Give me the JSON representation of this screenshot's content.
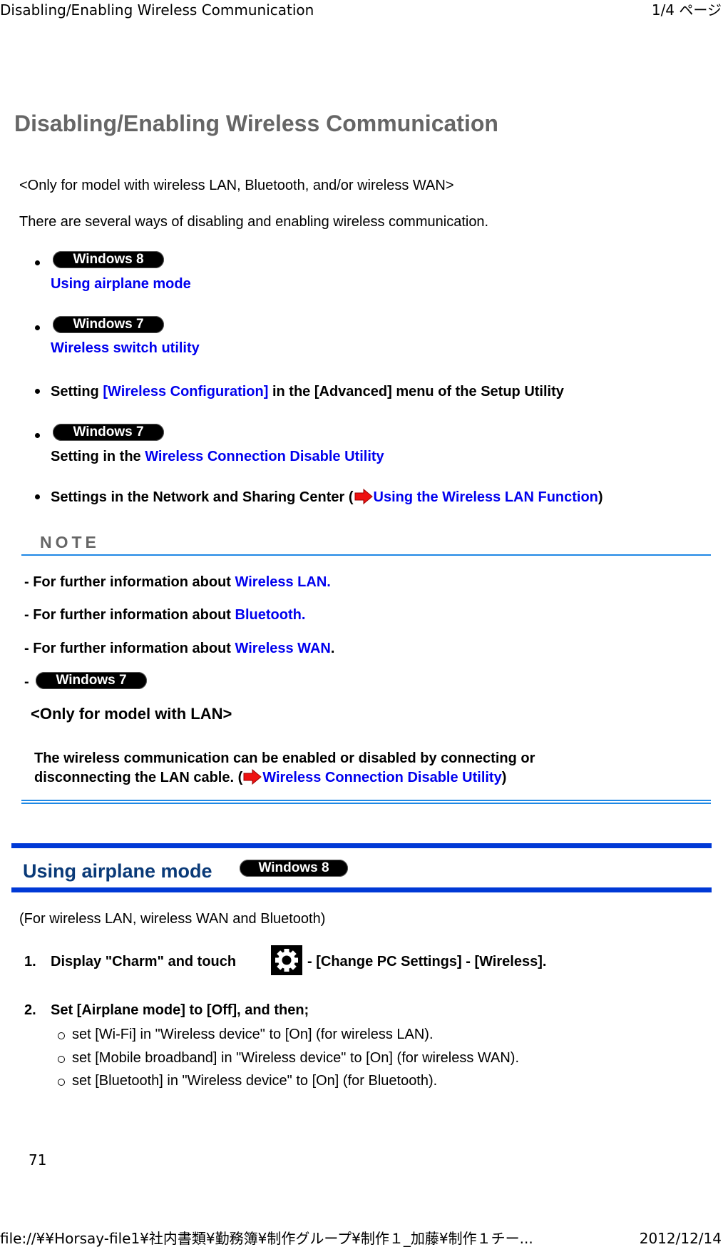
{
  "header": {
    "doc_title": "Disabling/Enabling Wireless Communication",
    "page_indicator": "1/4 ページ"
  },
  "page_title": "Disabling/Enabling Wireless Communication",
  "intro": {
    "scope": "<Only for model with wireless LAN, Bluetooth, and/or wireless WAN>",
    "summary": "There are several ways of disabling and enabling wireless communication."
  },
  "methods": [
    {
      "badge": "Windows 8",
      "link": "Using airplane mode"
    },
    {
      "badge": "Windows 7",
      "link": "Wireless switch utility"
    },
    {
      "prefix": "Setting ",
      "link": "[Wireless Configuration]",
      "suffix": " in the [Advanced] menu of the Setup Utility"
    },
    {
      "badge": "Windows 7",
      "prefix": "Setting in the ",
      "link": "Wireless Connection Disable Utility"
    },
    {
      "prefix": "Settings in the Network and Sharing Center (",
      "link": "Using the Wireless LAN Function",
      "suffix": ")"
    }
  ],
  "note": {
    "title": "NOTE",
    "items": [
      {
        "prefix": "- For further information about ",
        "link": "Wireless LAN.",
        "suffix": ""
      },
      {
        "prefix": "- For further information about ",
        "link": "Bluetooth.",
        "suffix": ""
      },
      {
        "prefix": "- For further information about ",
        "link": "Wireless WAN",
        "suffix": "."
      }
    ],
    "win7_dash": "-",
    "win7_badge": "Windows 7",
    "lan_scope": "<Only for model with LAN>",
    "lan_text_line1": "The wireless communication can be enabled or disabled by connecting or",
    "lan_text_line2_prefix": "disconnecting the LAN cable. (",
    "lan_text_link": "Wireless Connection Disable Utility",
    "lan_text_suffix": ")"
  },
  "section": {
    "heading": "Using airplane mode",
    "badge": "Windows 8",
    "applies_to": "(For wireless LAN, wireless WAN and Bluetooth)",
    "steps": [
      {
        "num": "1.",
        "prefix": "Display \"Charm\" and touch",
        "icon": "gear-icon",
        "suffix": "- [Change PC Settings] - [Wireless]."
      },
      {
        "num": "2.",
        "text": "Set [Airplane mode] to [Off], and then;"
      }
    ],
    "substeps": [
      "set [Wi-Fi] in \"Wireless device\" to [On] (for wireless LAN).",
      "set [Mobile broadband] in \"Wireless device\" to [On] (for wireless WAN).",
      "set [Bluetooth] in \"Wireless device\" to [On] (for Bluetooth)."
    ]
  },
  "page_number": "71",
  "footer": {
    "path": "file://¥¥Horsay-file1¥社内書類¥勤務簿¥制作グループ¥制作１_加藤¥制作１チー...",
    "date": "2012/12/14"
  },
  "colors": {
    "link": "#0000ee",
    "title_gray": "#666666",
    "note_line": "#1e88e5",
    "section_bar": "#0039d6",
    "section_heading": "#0a3a78",
    "arrow": "#ee1111"
  }
}
